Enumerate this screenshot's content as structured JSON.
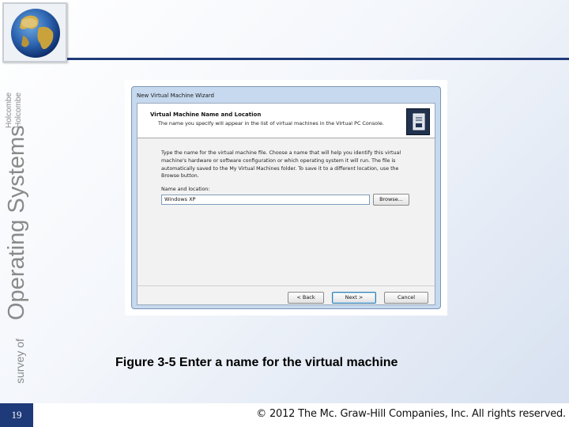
{
  "side_title": {
    "survey_of": "survey of",
    "operating_systems": "Operating Systems",
    "author1": "Holcombe",
    "author2": "Holcombe"
  },
  "dialog": {
    "window_title": "New Virtual Machine Wizard",
    "header_title": "Virtual Machine Name and Location",
    "header_subtitle": "The name you specify will appear in the list of virtual machines in the Virtual PC Console.",
    "instructions": "Type the name for the virtual machine file. Choose a name that will help you identify this virtual machine's hardware or software configuration or which operating system it will run. The file is automatically saved to the My Virtual Machines folder. To save it to a different location, use the Browse button.",
    "field_label": "Name and location:",
    "field_value": "Windows XP",
    "browse_label": "Browse...",
    "back_label": "< Back",
    "next_label": "Next >",
    "cancel_label": "Cancel"
  },
  "caption": "Figure 3-5 Enter a name for the virtual machine",
  "footer": {
    "page_number": "19",
    "copyright": "© 2012 The Mc. Graw-Hill Companies, Inc. All rights reserved."
  },
  "colors": {
    "accent_navy": "#1f3a78",
    "side_title_gray": "#8a8a8a"
  }
}
